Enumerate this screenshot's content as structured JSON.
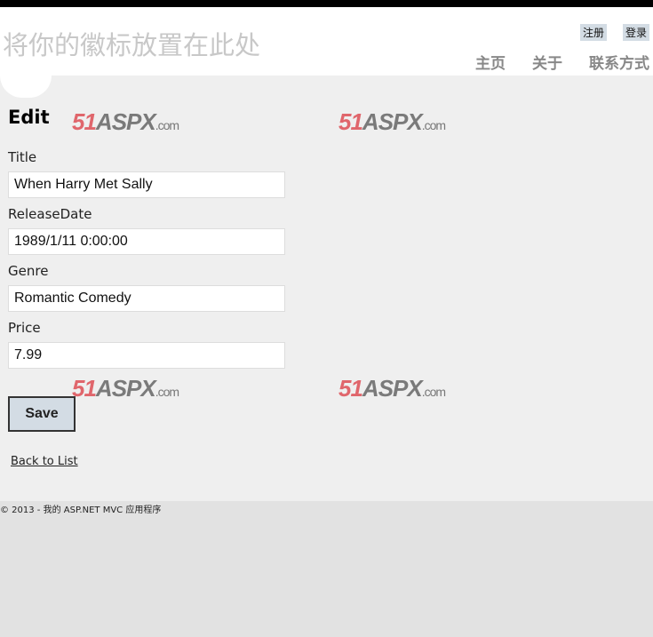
{
  "header": {
    "site_title": "将你的徽标放置在此处",
    "login_links": [
      "注册",
      "登录"
    ],
    "menu": [
      "主页",
      "关于",
      "联系方式"
    ]
  },
  "watermark": {
    "num": "51",
    "aspx": "ASPX",
    ".com": ".com",
    "text": "51ASPX.com"
  },
  "page": {
    "title": "Edit"
  },
  "form": {
    "fields": [
      {
        "label": "Title",
        "value": "When Harry Met Sally"
      },
      {
        "label": "ReleaseDate",
        "value": "1989/1/11 0:00:00"
      },
      {
        "label": "Genre",
        "value": "Romantic Comedy"
      },
      {
        "label": "Price",
        "value": "7.99"
      }
    ],
    "save_label": "Save"
  },
  "back_link": "Back to List",
  "footer": "© 2013 - 我的  ASP.NET MVC 应用程序"
}
